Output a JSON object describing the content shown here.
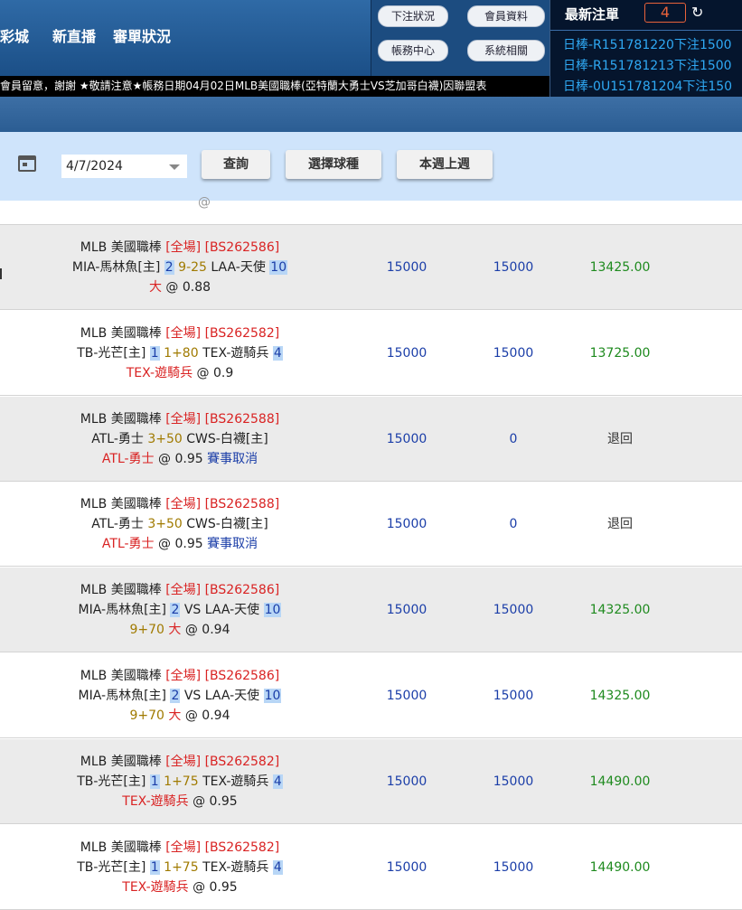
{
  "header": {
    "nav": [
      "彩城",
      "新直播",
      "審單狀況"
    ],
    "buttons": [
      "下注狀況",
      "會員資料",
      "帳務中心",
      "系統相關"
    ],
    "ticker": "會員留意，謝謝 ★敬請注意★帳務日期04月02日MLB美國職棒(亞特蘭大勇士VS芝加哥白襪)因聯盟表"
  },
  "latest": {
    "title": "最新注單",
    "count": "4",
    "refresh_icon": "↻",
    "items": [
      "日棒-R151781220下注1500",
      "日棒-R151781213下注1500",
      "日棒-0U151781204下注150"
    ]
  },
  "filter": {
    "date": "4/7/2024",
    "query_label": "查詢",
    "sport_label": "選擇球種",
    "week_label": "本週上週"
  },
  "partial_row": "@",
  "rows": [
    {
      "league": "MLB 美國職棒",
      "period": "[全場]",
      "code": "[BS262586]",
      "home": "MIA-馬林魚[主]",
      "hs": "2",
      "mid": "9-25",
      "away": "LAA-天使",
      "as": "10",
      "pick": "大",
      "odds": "@ 0.88",
      "pick_red": true,
      "bet": "15000",
      "valid": "15000",
      "result": "13425.00"
    },
    {
      "league": "MLB 美國職棒",
      "period": "[全場]",
      "code": "[BS262582]",
      "home": "TB-光芒[主]",
      "hs": "1",
      "mid": "1+80",
      "away": "TEX-遊騎兵",
      "as": "4",
      "pick": "TEX-遊騎兵",
      "odds": "@ 0.9",
      "pick_red": true,
      "bet": "15000",
      "valid": "15000",
      "result": "13725.00"
    },
    {
      "league": "MLB 美國職棒",
      "period": "[全場]",
      "code": "[BS262588]",
      "home": "ATL-勇士",
      "hs": "",
      "mid": "3+50",
      "away": "CWS-白襪[主]",
      "as": "",
      "pick": "ATL-勇士",
      "odds": "@ 0.95",
      "cancel": "賽事取消",
      "pick_red": true,
      "bet": "15000",
      "valid": "0",
      "result": "退回"
    },
    {
      "league": "MLB 美國職棒",
      "period": "[全場]",
      "code": "[BS262588]",
      "home": "ATL-勇士",
      "hs": "",
      "mid": "3+50",
      "away": "CWS-白襪[主]",
      "as": "",
      "pick": "ATL-勇士",
      "odds": "@ 0.95",
      "cancel": "賽事取消",
      "pick_red": true,
      "bet": "15000",
      "valid": "0",
      "result": "退回"
    },
    {
      "league": "MLB 美國職棒",
      "period": "[全場]",
      "code": "[BS262586]",
      "home": "MIA-馬林魚[主]",
      "hs": "2",
      "mid": "VS",
      "away": "LAA-天使",
      "as": "10",
      "line": "9+70",
      "pick": "大",
      "odds": "@ 0.94",
      "pick_red": true,
      "bet": "15000",
      "valid": "15000",
      "result": "14325.00"
    },
    {
      "league": "MLB 美國職棒",
      "period": "[全場]",
      "code": "[BS262586]",
      "home": "MIA-馬林魚[主]",
      "hs": "2",
      "mid": "VS",
      "away": "LAA-天使",
      "as": "10",
      "line": "9+70",
      "pick": "大",
      "odds": "@ 0.94",
      "pick_red": true,
      "bet": "15000",
      "valid": "15000",
      "result": "14325.00"
    },
    {
      "league": "MLB 美國職棒",
      "period": "[全場]",
      "code": "[BS262582]",
      "home": "TB-光芒[主]",
      "hs": "1",
      "mid": "1+75",
      "away": "TEX-遊騎兵",
      "as": "4",
      "pick": "TEX-遊騎兵",
      "odds": "@ 0.95",
      "pick_red": true,
      "bet": "15000",
      "valid": "15000",
      "result": "14490.00"
    },
    {
      "league": "MLB 美國職棒",
      "period": "[全場]",
      "code": "[BS262582]",
      "home": "TB-光芒[主]",
      "hs": "1",
      "mid": "1+75",
      "away": "TEX-遊騎兵",
      "as": "4",
      "pick": "TEX-遊騎兵",
      "odds": "@ 0.95",
      "pick_red": true,
      "bet": "15000",
      "valid": "15000",
      "result": "14490.00"
    }
  ]
}
